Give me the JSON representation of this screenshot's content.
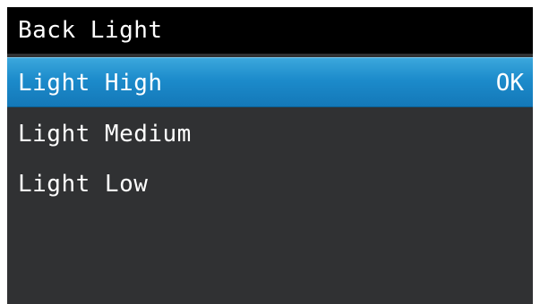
{
  "screen": {
    "title": "Back Light",
    "menu": [
      {
        "label": "Light High",
        "status": "OK",
        "selected": true
      },
      {
        "label": "Light Medium",
        "selected": false
      },
      {
        "label": "Light Low",
        "selected": false
      }
    ]
  },
  "colors": {
    "background": "#303133",
    "titlebar": "#000000",
    "selected_highlight": "#1c8bcb",
    "text": "#ffffff"
  }
}
